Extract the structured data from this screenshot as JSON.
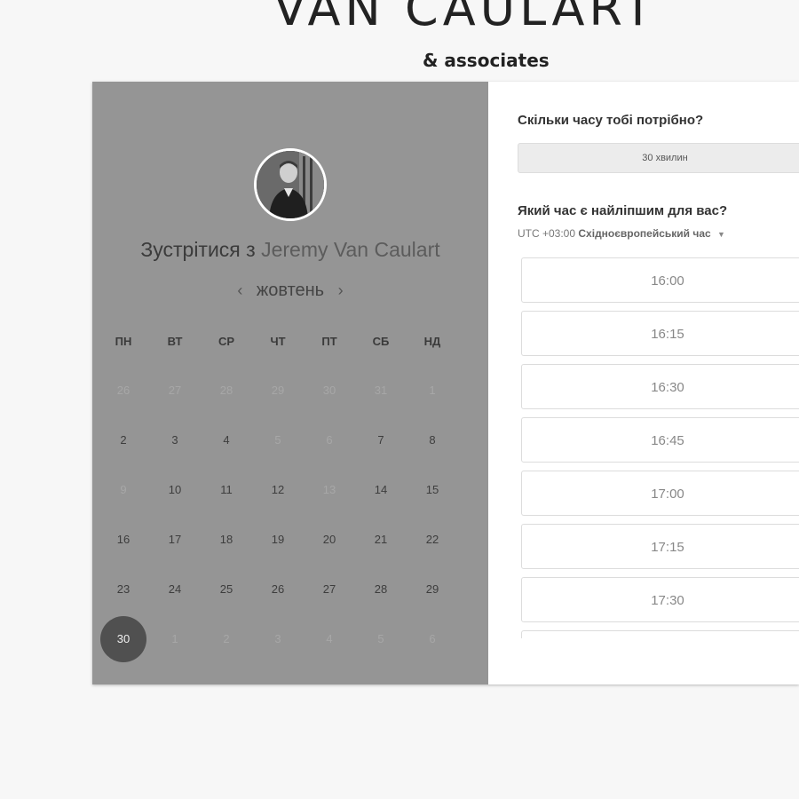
{
  "brand": {
    "title": "VAN CAULART",
    "subtitle": "& associates"
  },
  "host": {
    "meet_prefix": "Зустрітися з",
    "name": "Jeremy Van Caulart"
  },
  "calendar": {
    "month": "жовтень",
    "prev_arrow": "‹",
    "next_arrow": "›",
    "weekdays": [
      "ПН",
      "ВТ",
      "СР",
      "ЧТ",
      "ПТ",
      "СБ",
      "НД"
    ],
    "weeks": [
      [
        {
          "d": "26",
          "s": "muted"
        },
        {
          "d": "27",
          "s": "muted"
        },
        {
          "d": "28",
          "s": "muted"
        },
        {
          "d": "29",
          "s": "muted"
        },
        {
          "d": "30",
          "s": "muted"
        },
        {
          "d": "31",
          "s": "muted"
        },
        {
          "d": "1",
          "s": "muted"
        }
      ],
      [
        {
          "d": "2",
          "s": "available"
        },
        {
          "d": "3",
          "s": "available"
        },
        {
          "d": "4",
          "s": "available"
        },
        {
          "d": "5",
          "s": "muted"
        },
        {
          "d": "6",
          "s": "muted"
        },
        {
          "d": "7",
          "s": "available"
        },
        {
          "d": "8",
          "s": "available"
        }
      ],
      [
        {
          "d": "9",
          "s": "muted"
        },
        {
          "d": "10",
          "s": "available"
        },
        {
          "d": "11",
          "s": "available"
        },
        {
          "d": "12",
          "s": "available"
        },
        {
          "d": "13",
          "s": "muted"
        },
        {
          "d": "14",
          "s": "available"
        },
        {
          "d": "15",
          "s": "available"
        }
      ],
      [
        {
          "d": "16",
          "s": "available"
        },
        {
          "d": "17",
          "s": "available"
        },
        {
          "d": "18",
          "s": "available"
        },
        {
          "d": "19",
          "s": "available"
        },
        {
          "d": "20",
          "s": "available"
        },
        {
          "d": "21",
          "s": "available"
        },
        {
          "d": "22",
          "s": "available"
        }
      ],
      [
        {
          "d": "23",
          "s": "available"
        },
        {
          "d": "24",
          "s": "available"
        },
        {
          "d": "25",
          "s": "available"
        },
        {
          "d": "26",
          "s": "available"
        },
        {
          "d": "27",
          "s": "available"
        },
        {
          "d": "28",
          "s": "available"
        },
        {
          "d": "29",
          "s": "available"
        }
      ],
      [
        {
          "d": "30",
          "s": "selected"
        },
        {
          "d": "1",
          "s": "muted"
        },
        {
          "d": "2",
          "s": "muted"
        },
        {
          "d": "3",
          "s": "muted"
        },
        {
          "d": "4",
          "s": "muted"
        },
        {
          "d": "5",
          "s": "muted"
        },
        {
          "d": "6",
          "s": "muted"
        }
      ]
    ]
  },
  "booking": {
    "duration_question": "Скільки часу тобі потрібно?",
    "duration_value": "30 хвилин",
    "time_question": "Який час є найліпшим для вас?",
    "timezone_offset": "UTC +03:00",
    "timezone_name": "Східноєвропейський час",
    "slots": [
      "16:00",
      "16:15",
      "16:30",
      "16:45",
      "17:00",
      "17:15",
      "17:30",
      ""
    ]
  },
  "colors": {
    "left_panel": "#959595",
    "selected_day": "#505050",
    "page_bg": "#f7f7f7"
  },
  "icons": {
    "avatar": "host-photo",
    "prev": "chevron-left-icon",
    "next": "chevron-right-icon",
    "caret": "caret-down-icon"
  }
}
